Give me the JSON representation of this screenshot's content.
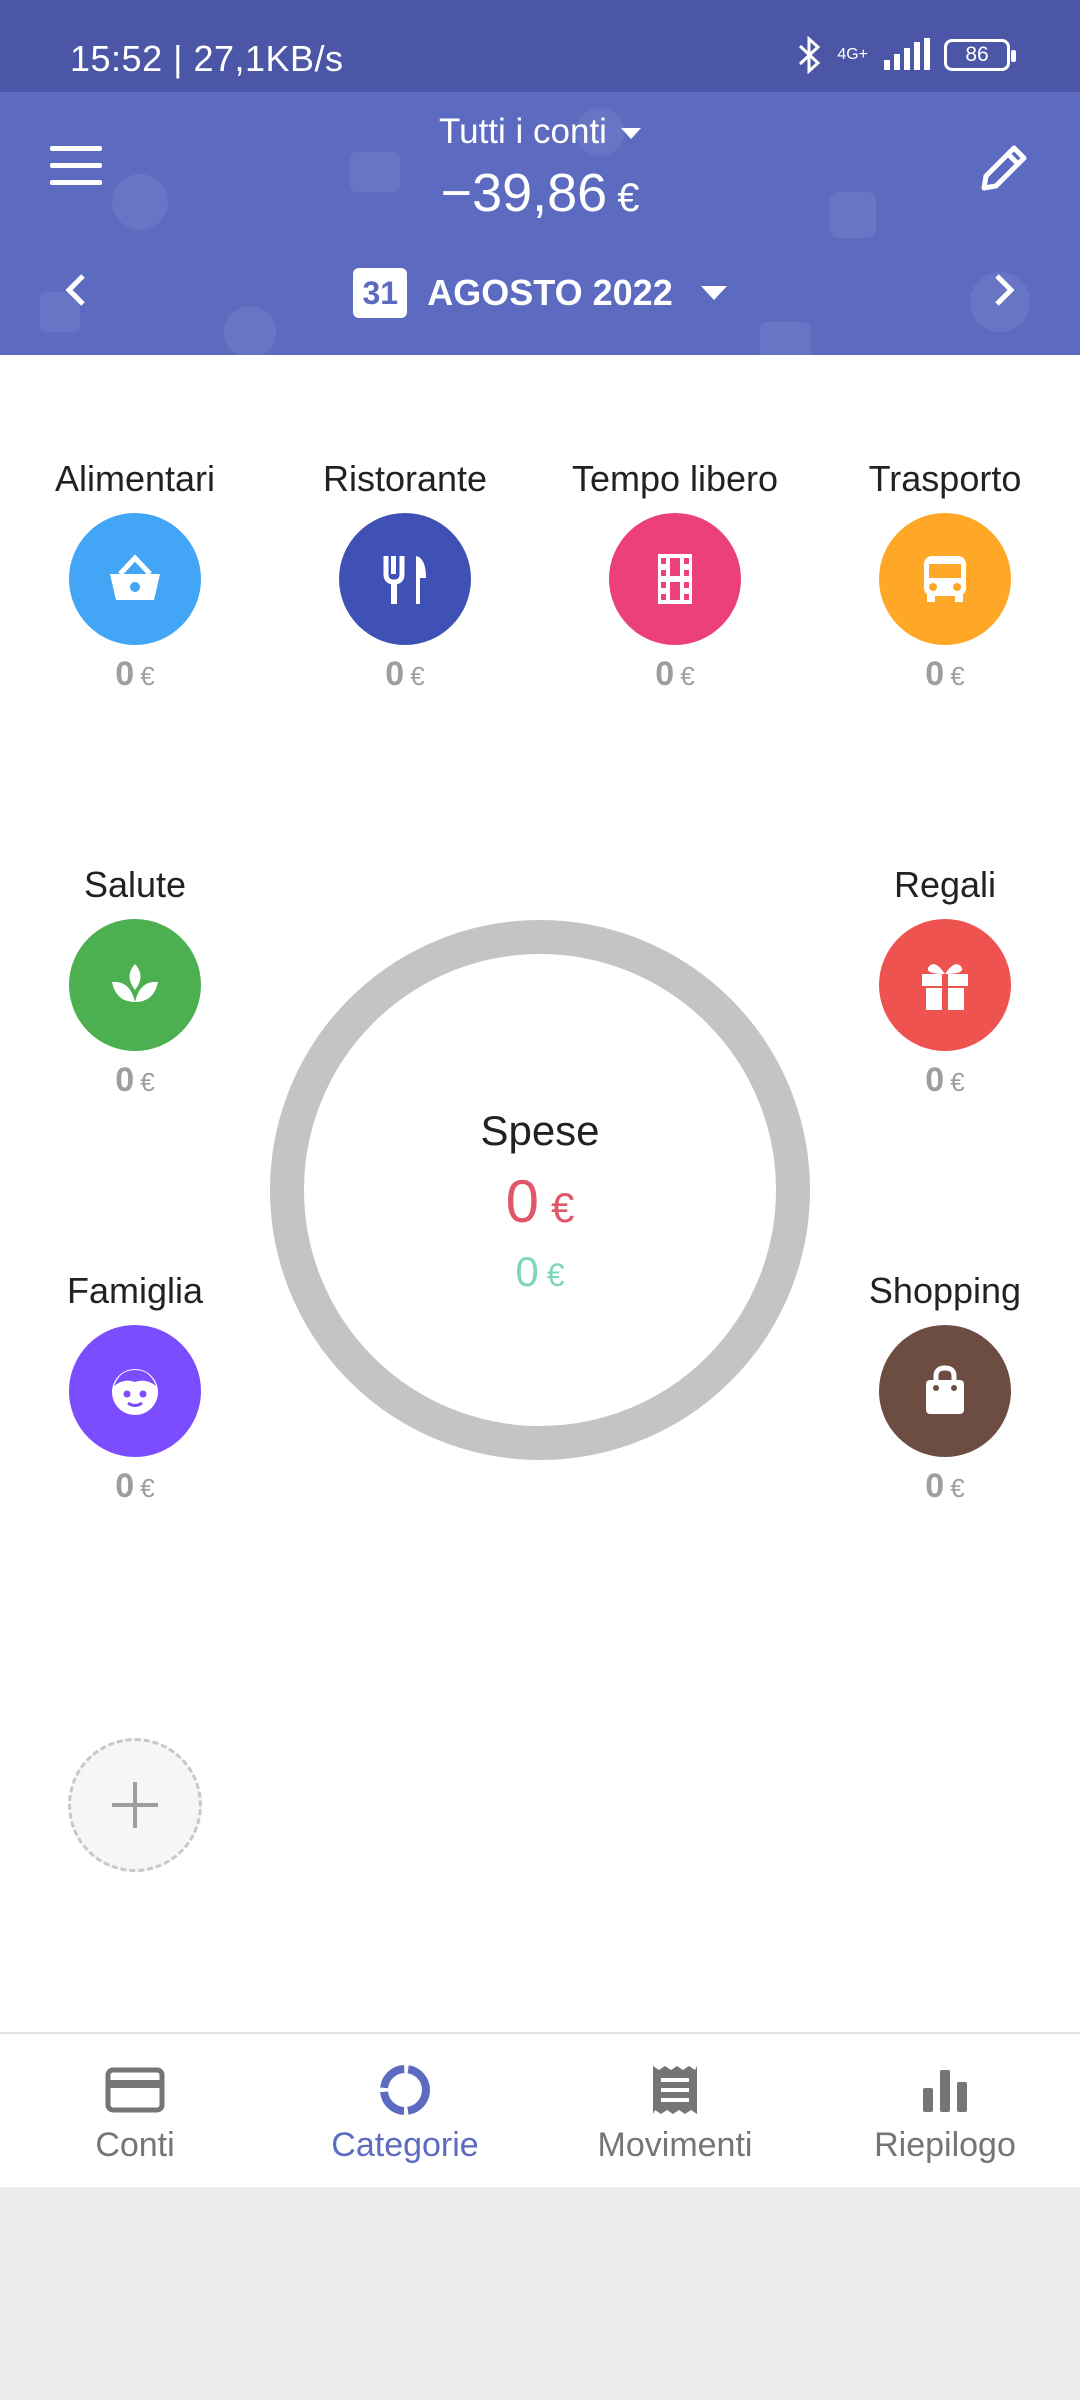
{
  "status": {
    "time": "15:52 | 27,1KB/s",
    "network": "4G+",
    "battery": "86"
  },
  "header": {
    "account": "Tutti i conti",
    "balance": "−39,86",
    "currency": "€",
    "calendar_day": "31",
    "period": "AGOSTO 2022"
  },
  "categories": [
    {
      "label": "Alimentari",
      "amount": "0",
      "currency": "€",
      "icon": "basket-icon",
      "color": "#42a5f5"
    },
    {
      "label": "Ristorante",
      "amount": "0",
      "currency": "€",
      "icon": "cutlery-icon",
      "color": "#3f51b5"
    },
    {
      "label": "Tempo libero",
      "amount": "0",
      "currency": "€",
      "icon": "film-icon",
      "color": "#ec407a"
    },
    {
      "label": "Trasporto",
      "amount": "0",
      "currency": "€",
      "icon": "bus-icon",
      "color": "#ffa726"
    },
    {
      "label": "Salute",
      "amount": "0",
      "currency": "€",
      "icon": "lotus-icon",
      "color": "#4caf50"
    },
    {
      "label": "Regali",
      "amount": "0",
      "currency": "€",
      "icon": "gift-icon",
      "color": "#ef5350"
    },
    {
      "label": "Famiglia",
      "amount": "0",
      "currency": "€",
      "icon": "child-face-icon",
      "color": "#7c4dff"
    },
    {
      "label": "Shopping",
      "amount": "0",
      "currency": "€",
      "icon": "shopping-bag-icon",
      "color": "#6d4c41"
    }
  ],
  "summary": {
    "title": "Spese",
    "expense": "0",
    "income": "0",
    "currency": "€",
    "expense_color": "#e0566a",
    "income_color": "#7fd6b8"
  },
  "nav": [
    {
      "label": "Conti",
      "icon": "card-icon",
      "active": false
    },
    {
      "label": "Categorie",
      "icon": "donut-icon",
      "active": true
    },
    {
      "label": "Movimenti",
      "icon": "receipt-icon",
      "active": false
    },
    {
      "label": "Riepilogo",
      "icon": "bar-chart-icon",
      "active": false
    }
  ]
}
